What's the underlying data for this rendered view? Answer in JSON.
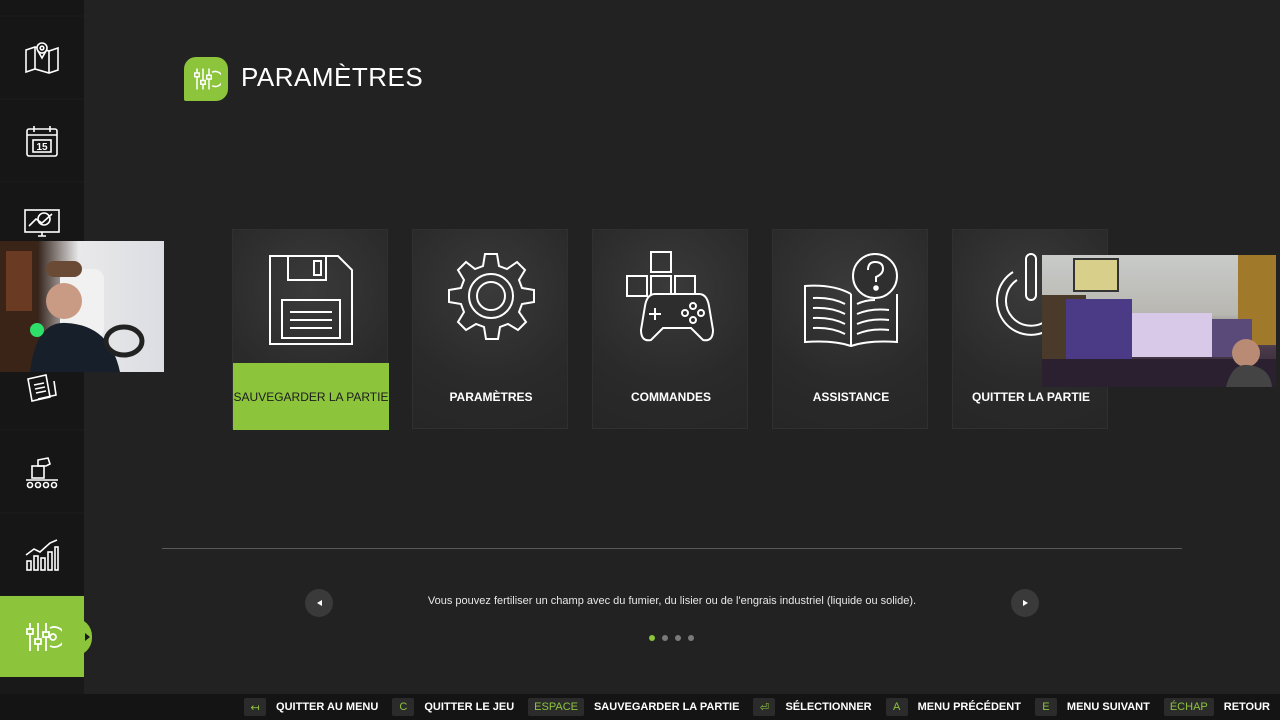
{
  "header": {
    "title": "PARAMÈTRES"
  },
  "sidebar": {
    "items": [
      {
        "icon": "map-icon"
      },
      {
        "icon": "calendar-icon",
        "text": "15"
      },
      {
        "icon": "stats-monitor-icon"
      },
      {
        "icon": "contracts-icon"
      },
      {
        "icon": "production-icon"
      },
      {
        "icon": "finance-chart-icon"
      },
      {
        "icon": "settings-sliders-icon",
        "active": true
      }
    ]
  },
  "menu": {
    "cards": [
      {
        "label": "SAUVEGARDER LA PARTIE",
        "icon": "floppy-disk-icon",
        "selected": true
      },
      {
        "label": "PARAMÈTRES",
        "icon": "gear-icon"
      },
      {
        "label": "COMMANDES",
        "icon": "gamepad-keys-icon"
      },
      {
        "label": "ASSISTANCE",
        "icon": "help-book-icon"
      },
      {
        "label": "QUITTER LA PARTIE",
        "icon": "power-icon"
      }
    ]
  },
  "tip": {
    "text": "Vous pouvez fertiliser un champ avec du fumier, du lisier ou de l'engrais industriel (liquide ou solide).",
    "page": 1,
    "pages": 4
  },
  "footer": {
    "hints": [
      {
        "key": "↤",
        "label": "QUITTER AU MENU"
      },
      {
        "key": "C",
        "label": "QUITTER LE JEU"
      },
      {
        "key": "ESPACE",
        "label": "SAUVEGARDER LA PARTIE"
      },
      {
        "key": "⏎",
        "label": "SÉLECTIONNER"
      },
      {
        "key": "A",
        "label": "MENU PRÉCÉDENT"
      },
      {
        "key": "E",
        "label": "MENU SUIVANT"
      },
      {
        "key": "ÉCHAP",
        "label": "RETOUR"
      }
    ]
  },
  "colors": {
    "accent": "#8cc43c",
    "background": "#222222",
    "sidebar": "#191919"
  }
}
